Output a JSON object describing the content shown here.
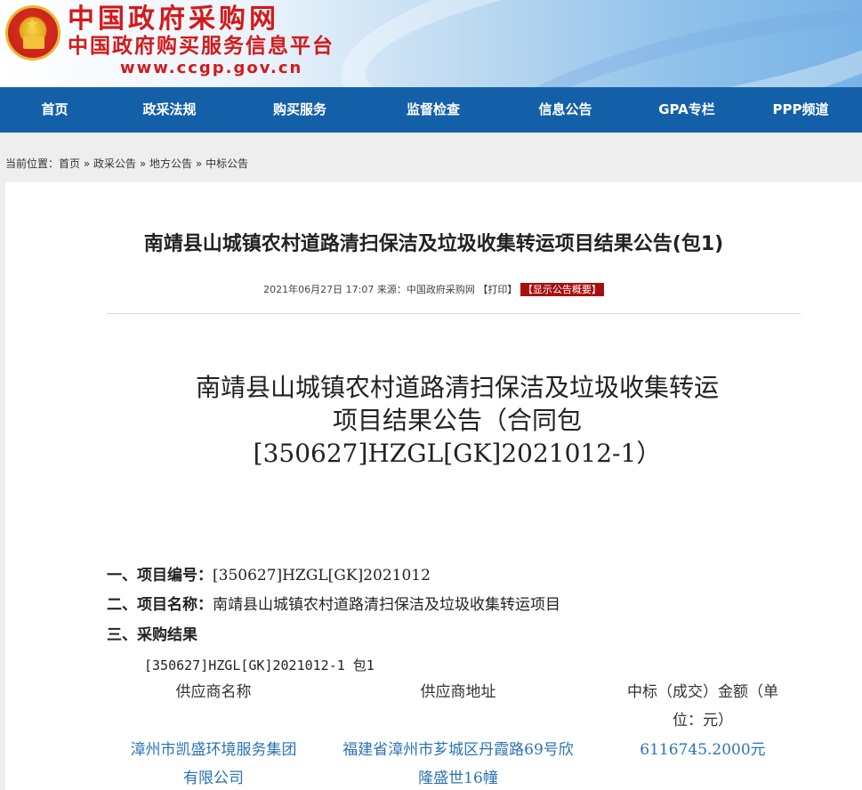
{
  "header": {
    "site_name": "中国政府采购网",
    "site_subtitle": "中国政府购买服务信息平台",
    "site_url": "www.ccgp.gov.cn",
    "emblem_icon": "national-emblem-icon"
  },
  "nav": {
    "items": [
      {
        "label": "首页"
      },
      {
        "label": "政采法规"
      },
      {
        "label": "购买服务"
      },
      {
        "label": "监督检查"
      },
      {
        "label": "信息公告"
      },
      {
        "label": "GPA专栏"
      },
      {
        "label": "PPP频道"
      }
    ]
  },
  "breadcrumb": {
    "prefix": "当前位置：",
    "items": [
      "首页",
      "政采公告",
      "地方公告",
      "中标公告"
    ],
    "separator": "»"
  },
  "article": {
    "title": "南靖县山城镇农村道路清扫保洁及垃圾收集转运项目结果公告(包1)",
    "date": "2021年06月27日 17:07",
    "source_label": "来源：",
    "source": "中国政府采购网",
    "print_label": "【打印】",
    "summary_label": "【显示公告概要】",
    "doc_title_line1": "南靖县山城镇农村道路清扫保洁及垃圾收集转运",
    "doc_title_line2": "项目结果公告（合同包",
    "doc_title_line3": "[350627]HZGL[GK]2021012-1）",
    "sections": [
      {
        "heading": "一、项目编号：",
        "value": "[350627]HZGL[GK]2021012"
      },
      {
        "heading": "二、项目名称：",
        "value": "南靖县山城镇农村道路清扫保洁及垃圾收集转运项目"
      },
      {
        "heading": "三、采购结果",
        "value": ""
      }
    ],
    "package_line": "[350627]HZGL[GK]2021012-1 包1",
    "table": {
      "headers": [
        "供应商名称",
        "供应商地址",
        "中标（成交）金额（单",
        "位：元）"
      ],
      "row": {
        "name_line1": "漳州市凯盛环境服务集团",
        "name_line2": "有限公司",
        "addr_line1": "福建省漳州市芗城区丹霞路69号欣",
        "addr_line2": "隆盛世16幢",
        "amount": "6116745.2000元"
      }
    }
  },
  "colors": {
    "nav_bg": "#1460a8",
    "logo_red": "#d4191a",
    "summary_badge": "#a70f0f",
    "link_blue": "#2a72b6"
  }
}
